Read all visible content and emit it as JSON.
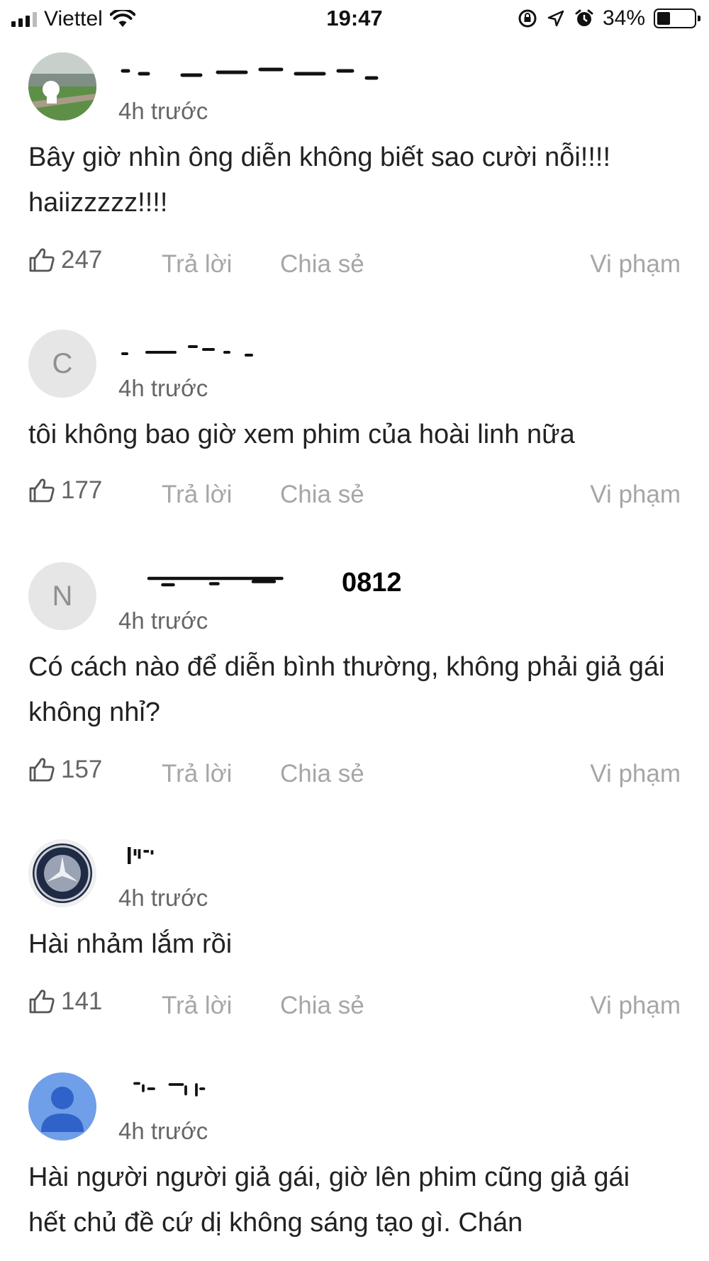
{
  "status_bar": {
    "carrier": "Viettel",
    "time": "19:47",
    "battery_percent": "34%",
    "battery_level": 0.34
  },
  "comments": [
    {
      "username": "",
      "time_ago": "4h trước",
      "text": "Bây giờ nhìn ông diễn không biết sao cười nỗi!!!! haiizzzzz!!!!",
      "likes": "247",
      "reply_label": "Trả lời",
      "share_label": "Chia sẻ",
      "report_label": "Vi phạm"
    },
    {
      "avatar_letter": "C",
      "username": "",
      "time_ago": "4h trước",
      "text": "tôi không bao giờ xem phim của hoài linh nữa",
      "likes": "177",
      "reply_label": "Trả lời",
      "share_label": "Chia sẻ",
      "report_label": "Vi phạm"
    },
    {
      "avatar_letter": "N",
      "username": "0812",
      "time_ago": "4h trước",
      "text": "Có cách nào để diễn bình thường, không phải giả gái không nhỉ?",
      "likes": "157",
      "reply_label": "Trả lời",
      "share_label": "Chia sẻ",
      "report_label": "Vi phạm"
    },
    {
      "username": "",
      "time_ago": "4h trước",
      "text": "Hài nhảm lắm rồi",
      "likes": "141",
      "reply_label": "Trả lời",
      "share_label": "Chia sẻ",
      "report_label": "Vi phạm"
    },
    {
      "username": "",
      "time_ago": "4h trước",
      "text": "Hài người người giả gái, giờ lên phim cũng giả gái hết chủ đề cứ dị không sáng tạo gì. Chán"
    }
  ],
  "icons": {
    "like": "thumbs-up-icon",
    "avatar_generic": "person-icon",
    "avatar_logo": "mercedes-logo-icon",
    "avatar_photo": "landscape-photo"
  },
  "colors": {
    "muted_text": "#a6a6a6",
    "time_text": "#666666",
    "letter_avatar_bg": "#e6e6e6",
    "person_avatar_bg": "#6f9fe8"
  }
}
